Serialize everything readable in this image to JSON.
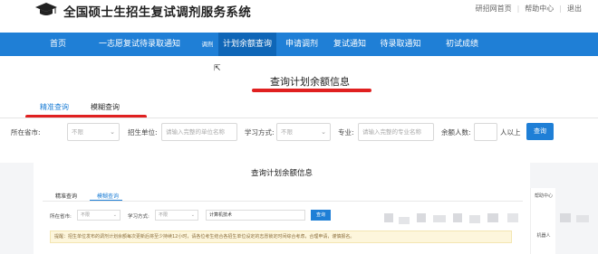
{
  "header": {
    "title": "全国硕士生招生复试调剂服务系统",
    "links": [
      "研招网首页",
      "帮助中心",
      "退出"
    ]
  },
  "nav": {
    "items": [
      "首页",
      "一志愿复试待录取通知",
      "调剂",
      "计划余额查询",
      "申请调剂",
      "复试通知",
      "待录取通知",
      "初试成绩"
    ]
  },
  "main": {
    "heading": "查询计划余额信息",
    "tabs": [
      "精准查询",
      "模糊查询"
    ]
  },
  "filters": {
    "province_label": "所在省市:",
    "province_value": "不限",
    "unit_label": "招生单位:",
    "unit_placeholder": "请输入完整的单位名称",
    "study_label": "学习方式:",
    "study_value": "不限",
    "major_label": "专业:",
    "major_placeholder": "请输入完整的专业名称",
    "balance_label": "余额人数:",
    "balance_suffix": "人以上",
    "search_button": "查询"
  },
  "lower": {
    "heading": "查询计划余额信息",
    "tabs": [
      "精准查询",
      "模糊查询"
    ],
    "province_label": "所在省市:",
    "province_value": "不限",
    "study_label": "学习方式:",
    "study_value": "不限",
    "keyword_value": "计算机技术",
    "search_button": "查询",
    "notice": "提醒：招生单位发布的调剂计划余额每次更新后将至少持续12小时，请各位考生结合各招生单位设定的志愿锁定时间综合考虑，合理申请，谨慎报名。",
    "side_items": [
      "帮助中心",
      "机器人"
    ]
  },
  "colors": {
    "nav_bg": "#1f7fd6",
    "nav_active": "#0f66b7",
    "highlight_red": "#e02020",
    "link_blue": "#1f7fd6"
  }
}
